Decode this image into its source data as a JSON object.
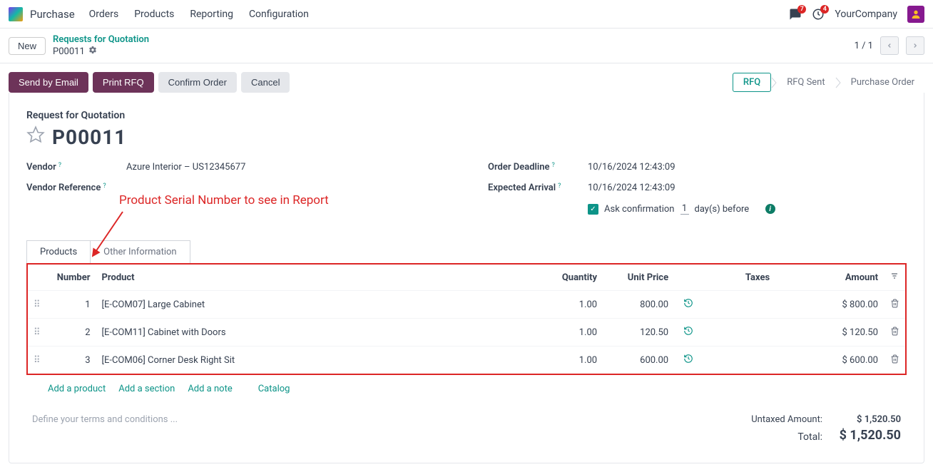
{
  "topbar": {
    "app": "Purchase",
    "menu": [
      "Orders",
      "Products",
      "Reporting",
      "Configuration"
    ],
    "badges": {
      "chat": "7",
      "activity": "4"
    },
    "company": "YourCompany"
  },
  "subbar": {
    "new": "New",
    "breadcrumb_link": "Requests for Quotation",
    "breadcrumb_current": "P00011",
    "pager": "1 / 1"
  },
  "actions": {
    "send": "Send by Email",
    "print": "Print RFQ",
    "confirm": "Confirm Order",
    "cancel": "Cancel"
  },
  "status": {
    "rfq": "RFQ",
    "sent": "RFQ Sent",
    "po": "Purchase Order"
  },
  "sheet": {
    "title_label": "Request for Quotation",
    "number": "P00011",
    "vendor_label": "Vendor",
    "vendor_value": "Azure Interior – US12345677",
    "vendor_ref_label": "Vendor Reference",
    "deadline_label": "Order Deadline",
    "deadline_value": "10/16/2024 12:43:09",
    "arrival_label": "Expected Arrival",
    "arrival_value": "10/16/2024 12:43:09",
    "ask_conf": "Ask confirmation",
    "ask_days": "1",
    "ask_suffix": "day(s) before"
  },
  "annotation": "Product Serial Number to see in Report",
  "tabs": {
    "products": "Products",
    "other": "Other Information"
  },
  "table": {
    "headers": {
      "number": "Number",
      "product": "Product",
      "qty": "Quantity",
      "price": "Unit Price",
      "taxes": "Taxes",
      "amount": "Amount"
    },
    "rows": [
      {
        "n": "1",
        "product": "[E-COM07] Large Cabinet",
        "qty": "1.00",
        "price": "800.00",
        "amount": "$ 800.00"
      },
      {
        "n": "2",
        "product": "[E-COM11] Cabinet with Doors",
        "qty": "1.00",
        "price": "120.50",
        "amount": "$ 120.50"
      },
      {
        "n": "3",
        "product": "[E-COM06] Corner Desk Right Sit",
        "qty": "1.00",
        "price": "600.00",
        "amount": "$ 600.00"
      }
    ]
  },
  "line_links": {
    "add_product": "Add a product",
    "add_section": "Add a section",
    "add_note": "Add a note",
    "catalog": "Catalog"
  },
  "terms_placeholder": "Define your terms and conditions ...",
  "totals": {
    "untaxed_lbl": "Untaxed Amount:",
    "untaxed_val": "$ 1,520.50",
    "total_lbl": "Total:",
    "total_val": "$ 1,520.50"
  }
}
